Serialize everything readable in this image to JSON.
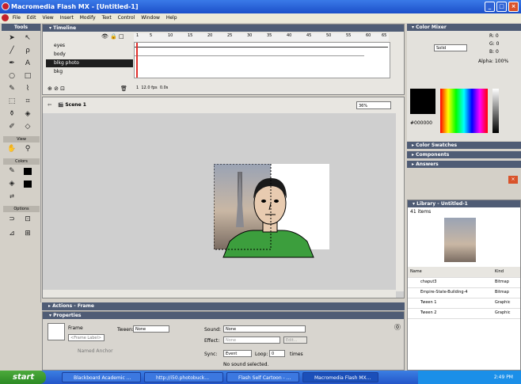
{
  "window": {
    "title": "Macromedia Flash MX - [Untitled-1]"
  },
  "menu": [
    "File",
    "Edit",
    "View",
    "Insert",
    "Modify",
    "Text",
    "Control",
    "Window",
    "Help"
  ],
  "tools": {
    "title": "Tools",
    "view_label": "View",
    "colors_label": "Colors",
    "options_label": "Options"
  },
  "timeline": {
    "title": "Timeline",
    "layers": [
      {
        "name": "eyes"
      },
      {
        "name": "body"
      },
      {
        "name": "blkg photo"
      },
      {
        "name": "bkg"
      }
    ],
    "ruler": [
      "1",
      "5",
      "10",
      "15",
      "20",
      "25",
      "30",
      "35",
      "40",
      "45",
      "50",
      "55",
      "60",
      "65"
    ],
    "fps": "12.0 fps",
    "time": "0.0s",
    "frame": "1"
  },
  "stage": {
    "scene": "Scene 1",
    "zoom": "36%"
  },
  "actions": {
    "title": "Actions - Frame"
  },
  "properties": {
    "title": "Properties",
    "frame_label": "Frame",
    "frame_placeholder": "<Frame Label>",
    "named_anchor": "Named Anchor",
    "tween_label": "Tween:",
    "tween_value": "None",
    "sound_label": "Sound:",
    "sound_value": "None",
    "effect_label": "Effect:",
    "effect_value": "None",
    "edit_button": "Edit...",
    "sync_label": "Sync:",
    "sync_value": "Event",
    "loop_label": "Loop:",
    "loop_value": "0",
    "times": "times",
    "no_sound": "No sound selected."
  },
  "color_mixer": {
    "title": "Color Mixer",
    "r": "R: 0",
    "g": "G: 0",
    "b": "B: 0",
    "alpha": "Alpha: 100%",
    "fill_type": "Solid",
    "hex": "#000000"
  },
  "collapsed_panels": [
    "Color Swatches",
    "Components",
    "Answers"
  ],
  "library": {
    "title": "Library - Untitled-1",
    "count": "41 items",
    "col_name": "Name",
    "col_kind": "Kind",
    "items": [
      {
        "name": "chaput3",
        "kind": "Bitmap"
      },
      {
        "name": "Empire-State-Building-4",
        "kind": "Bitmap"
      },
      {
        "name": "Tween 1",
        "kind": "Graphic"
      },
      {
        "name": "Tween 2",
        "kind": "Graphic"
      }
    ]
  },
  "taskbar": {
    "start": "start",
    "tasks": [
      "Blackboard Academic ...",
      "http://i50.photobuck...",
      "Flash Self Cartoon - ...",
      "Macromedia Flash MX..."
    ],
    "clock": "2:49 PM"
  }
}
